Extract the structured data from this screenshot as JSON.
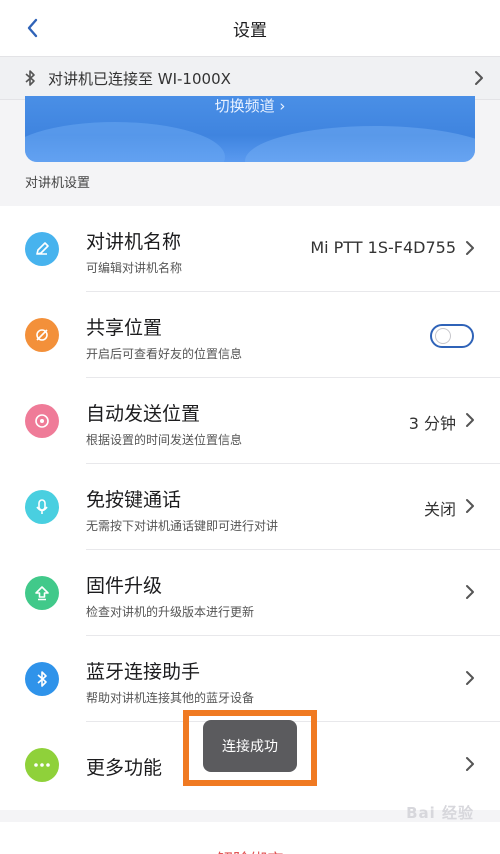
{
  "header": {
    "title": "设置"
  },
  "bt_status": {
    "text": "对讲机已连接至 WI-1000X"
  },
  "banner": {
    "label": "切换频道 ›"
  },
  "section": {
    "label": "对讲机设置"
  },
  "rows": [
    {
      "title": "对讲机名称",
      "subtitle": "可编辑对讲机名称",
      "value": "Mi PTT 1S-F4D755",
      "icon": "edit-icon",
      "color": "#47b3ee"
    },
    {
      "title": "共享位置",
      "subtitle": "开启后可查看好友的位置信息",
      "toggle_on": false,
      "icon": "location-share-icon",
      "color": "#f3903a"
    },
    {
      "title": "自动发送位置",
      "subtitle": "根据设置的时间发送位置信息",
      "value": "3 分钟",
      "icon": "target-icon",
      "color": "#ef7b98"
    },
    {
      "title": "免按键通话",
      "subtitle": "无需按下对讲机通话键即可进行对讲",
      "value": "关闭",
      "icon": "microphone-icon",
      "color": "#49cfe0"
    },
    {
      "title": "固件升级",
      "subtitle": "检查对讲机的升级版本进行更新",
      "icon": "upgrade-icon",
      "color": "#41c98a"
    },
    {
      "title": "蓝牙连接助手",
      "subtitle": "帮助对讲机连接其他的蓝牙设备",
      "icon": "bluetooth-icon",
      "color": "#2f93ea"
    },
    {
      "title": "更多功能",
      "icon": "more-icon",
      "color": "#8fd13a"
    }
  ],
  "toast": {
    "text": "连接成功"
  },
  "bottom": {
    "action_label": "解除绑定"
  },
  "watermark": {
    "text": "Bai 经验"
  },
  "colors": {
    "accent": "#2f63b8",
    "highlight": "#f07a22",
    "danger": "#e25555"
  }
}
